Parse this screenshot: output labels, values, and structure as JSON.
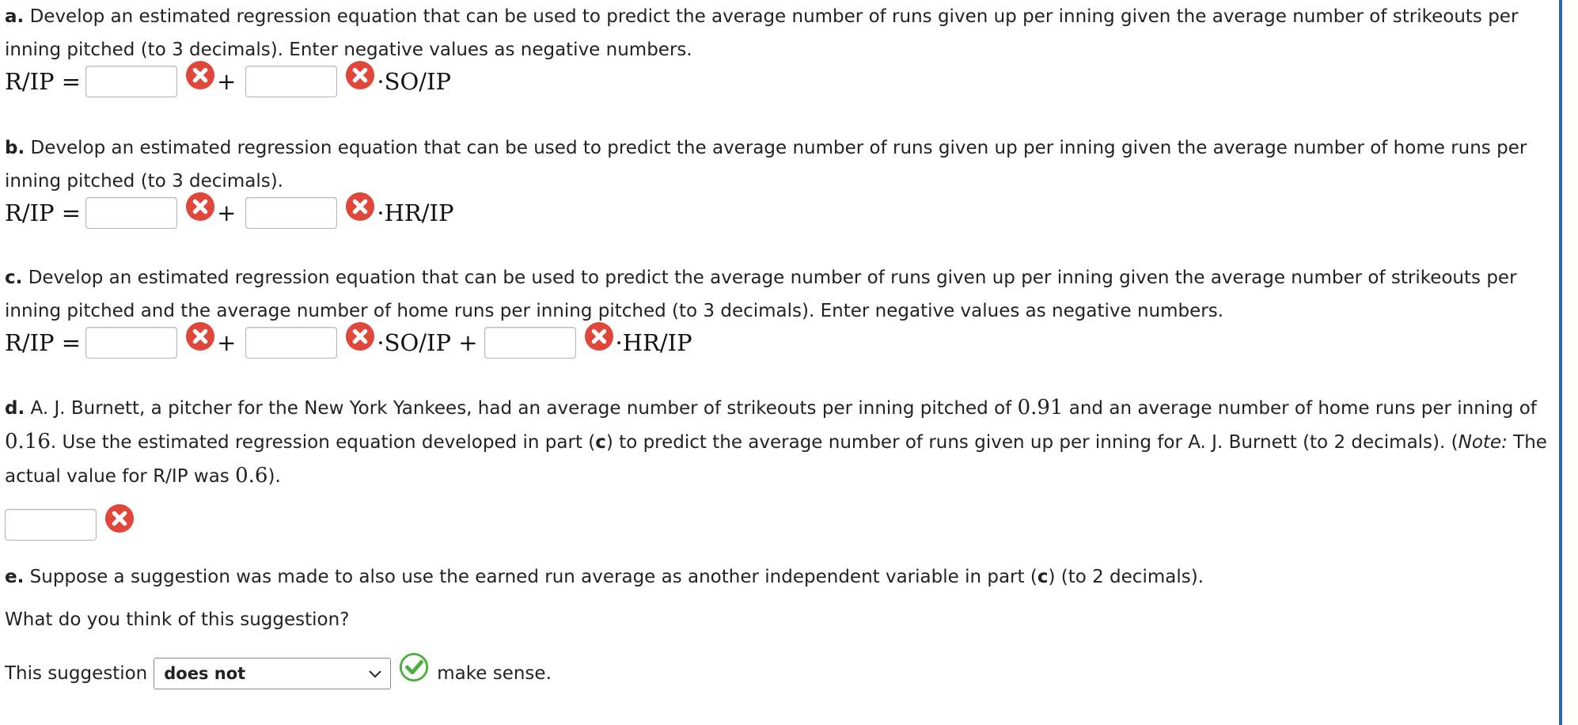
{
  "part_a": {
    "letter": "a.",
    "text": "Develop an estimated regression equation that can be used to predict the average number of runs given up per inning given the average number of strikeouts per inning pitched (to 3 decimals). Enter negative values as negative numbers.",
    "lhs": "R/IP =",
    "plus": "+",
    "term": "·SO/IP"
  },
  "part_b": {
    "letter": "b.",
    "text": "Develop an estimated regression equation that can be used to predict the average number of runs given up per inning given the average number of home runs per inning pitched (to 3 decimals).",
    "lhs": "R/IP =",
    "plus": "+",
    "term": "·HR/IP"
  },
  "part_c": {
    "letter": "c.",
    "text": "Develop an estimated regression equation that can be used to predict the average number of runs given up per inning given the average number of strikeouts per inning pitched and the average number of home runs per inning pitched (to 3 decimals). Enter negative values as negative numbers.",
    "lhs": "R/IP =",
    "plus": "+",
    "term1": "·SO/IP +",
    "term2": "·HR/IP"
  },
  "part_d": {
    "letter": "d.",
    "text1": "A. J. Burnett, a pitcher for the New York Yankees, had an average number of strikeouts per inning pitched of",
    "so_value": "0.91",
    "text2": "and an average number of home runs per inning of",
    "hr_value": "0.16",
    "text3": ". Use the estimated regression equation developed in part (",
    "part_ref": "c",
    "text4": ") to predict the average number of runs given up per inning for A. J. Burnett (to 2 decimals). (",
    "note_label": "Note:",
    "text5": "The actual value for R/IP was",
    "actual_value": "0.6",
    "text6": ")."
  },
  "part_e": {
    "letter": "e.",
    "text1": "Suppose a suggestion was made to also use the earned run average as another independent variable in part (",
    "part_ref": "c",
    "text2": ") (to 2 decimals).",
    "question": "What do you think of this suggestion?",
    "prefix": "This suggestion",
    "selected": "does not",
    "suffix": "make sense."
  },
  "icons": {
    "incorrect": "incorrect-x-icon",
    "correct": "correct-check-icon",
    "incorrect_color": "#e0463a",
    "correct_color": "#47b03a"
  },
  "accent_color": "#2a66b5"
}
